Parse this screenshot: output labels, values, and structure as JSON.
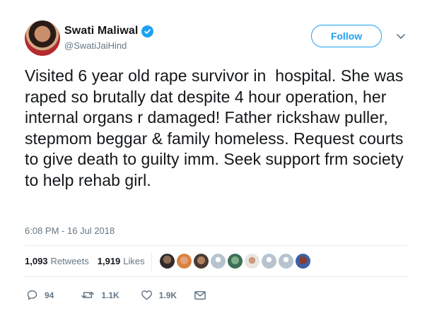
{
  "author": {
    "name": "Swati Maliwal",
    "handle": "@SwatiJaiHind",
    "verified": true
  },
  "follow_label": "Follow",
  "tweet_text": "Visited 6 year old rape survivor in  hospital. She was raped so brutally dat despite 4 hour operation, her internal organs r damaged! Father rickshaw puller, stepmom beggar & family homeless. Request courts to give death to guilty imm. Seek support frm society to help rehab girl.",
  "timestamp": "6:08 PM - 16 Jul 2018",
  "stats": {
    "retweets_count": "1,093",
    "retweets_label": "Retweets",
    "likes_count": "1,919",
    "likes_label": "Likes"
  },
  "actions": {
    "reply_count": "94",
    "retweet_count": "1.1K",
    "like_count": "1.9K"
  },
  "colors": {
    "accent": "#1da1f2",
    "text": "#14171a",
    "muted": "#657786",
    "divider": "#e6ecf0"
  }
}
